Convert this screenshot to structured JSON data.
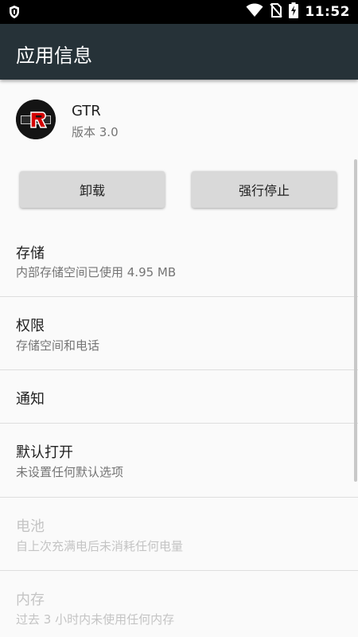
{
  "status_bar": {
    "time": "11:52"
  },
  "toolbar": {
    "title": "应用信息"
  },
  "app": {
    "name": "GTR",
    "version": "版本 3.0"
  },
  "buttons": {
    "uninstall": "卸载",
    "force_stop": "强行停止"
  },
  "items": [
    {
      "title": "存储",
      "subtitle": "内部存储空间已使用 4.95 MB"
    },
    {
      "title": "权限",
      "subtitle": "存储空间和电话"
    },
    {
      "title": "通知"
    },
    {
      "title": "默认打开",
      "subtitle": "未设置任何默认选项"
    },
    {
      "title": "电池",
      "subtitle": "自上次充满电后未消耗任何电量"
    },
    {
      "title": "内存",
      "subtitle": "过去 3 小时内未使用任何内存"
    }
  ],
  "colors": {
    "toolbar": "#263238",
    "status_bar": "#000000",
    "button": "#d9d9d9",
    "background": "#fafafa"
  }
}
